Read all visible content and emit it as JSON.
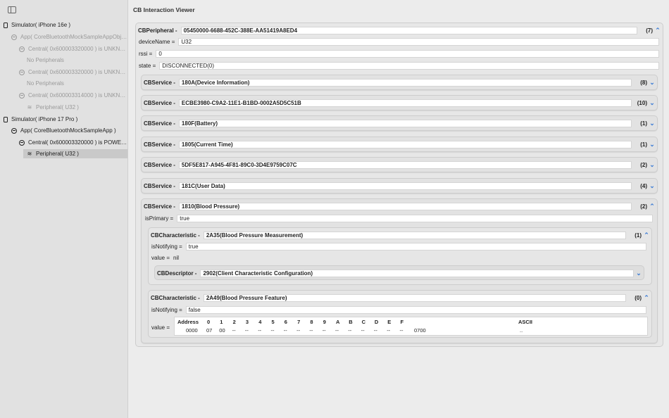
{
  "sidebar": {
    "items": [
      {
        "label": "Simulator( iPhone 16e )",
        "icon": "phone-icon"
      },
      {
        "label": "App( CoreBluetoothMockSampleAppObjC )",
        "icon": "app-icon"
      },
      {
        "label": "Central( 0x600003320000 ) is UNKNO...",
        "icon": "central-icon"
      },
      {
        "label": "No Peripherals"
      },
      {
        "label": "Central( 0x600003320000 ) is UNKNO...",
        "icon": "central-icon"
      },
      {
        "label": "No Peripherals"
      },
      {
        "label": "Central( 0x600003314000 ) is UNKNO...",
        "icon": "central-icon"
      },
      {
        "label": "Peripheral( U32 )",
        "icon": "antenna-icon"
      },
      {
        "label": "Simulator( iPhone 17 Pro )",
        "icon": "phone-icon"
      },
      {
        "label": "App( CoreBluetoothMockSampleApp )",
        "icon": "app-icon"
      },
      {
        "label": "Central( 0x600003320000 ) is POWER...",
        "icon": "central-icon"
      },
      {
        "label": "Peripheral( U32 )",
        "icon": "antenna-icon"
      }
    ]
  },
  "main": {
    "title": "CB Interaction Viewer",
    "peripheral": {
      "kind": "CBPeripheral -",
      "uuid": "05450000-6688-452C-388E-AA51419A8ED4",
      "count": "(7)",
      "device_name_label": "deviceName =",
      "device_name": "U32",
      "rssi_label": "rssi =",
      "rssi": "0",
      "state_label": "state =",
      "state": "DISCONNECTED(0)"
    },
    "services": [
      {
        "kind": "CBService -",
        "value": "180A(Device Information)",
        "count": "(8)"
      },
      {
        "kind": "CBService -",
        "value": "ECBE3980-C9A2-11E1-B1BD-0002A5D5C51B",
        "count": "(10)"
      },
      {
        "kind": "CBService -",
        "value": "180F(Battery)",
        "count": "(1)"
      },
      {
        "kind": "CBService -",
        "value": "1805(Current Time)",
        "count": "(1)"
      },
      {
        "kind": "CBService -",
        "value": "5DF5E817-A945-4F81-89C0-3D4E9759C07C",
        "count": "(2)"
      },
      {
        "kind": "CBService -",
        "value": "181C(User Data)",
        "count": "(4)"
      }
    ],
    "bp_service": {
      "kind": "CBService -",
      "value": "1810(Blood Pressure)",
      "count": "(2)",
      "is_primary_label": "isPrimary =",
      "is_primary": "true"
    },
    "char1": {
      "kind": "CBCharacteristic -",
      "value": "2A35(Blood Pressure Measurement)",
      "count": "(1)",
      "notifying_label": "isNotifying =",
      "notifying": "true",
      "value_label": "value =",
      "value_text": "nil",
      "descriptor_kind": "CBDescriptor -",
      "descriptor_value": "2902(Client Characteristic Configuration)"
    },
    "char2": {
      "kind": "CBCharacteristic -",
      "value": "2A49(Blood Pressure Feature)",
      "count": "(0)",
      "notifying_label": "isNotifying =",
      "notifying": "false",
      "value_label": "value =",
      "hex": {
        "address_header": "Address",
        "columns": [
          "0",
          "1",
          "2",
          "3",
          "4",
          "5",
          "6",
          "7",
          "8",
          "9",
          "A",
          "B",
          "C",
          "D",
          "E",
          "F"
        ],
        "ascii_header": "ASCII",
        "address": "0000",
        "bytes": [
          "07",
          "00",
          "--",
          "--",
          "--",
          "--",
          "--",
          "--",
          "--",
          "--",
          "--",
          "--",
          "--",
          "--",
          "--",
          "--"
        ],
        "hex_string": "0700",
        "ascii": ".."
      }
    }
  },
  "colors": {
    "accent": "#3a7bd5",
    "sidebar_bg": "#e1e1e1",
    "selected_bg": "#c9c9c9"
  }
}
